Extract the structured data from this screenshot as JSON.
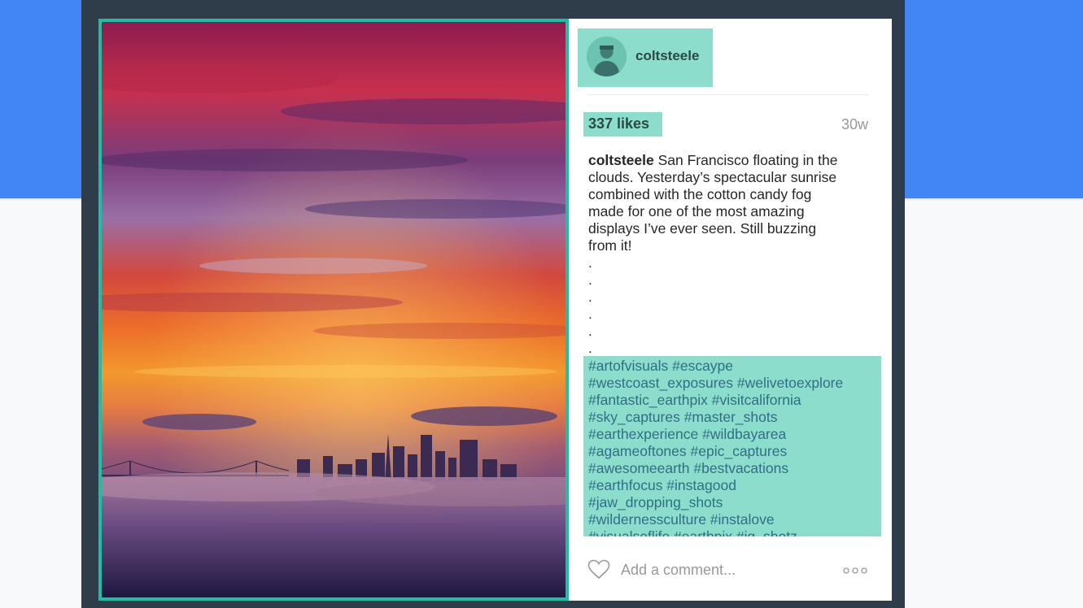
{
  "post": {
    "username": "coltsteele",
    "likes": "337 likes",
    "age": "30w",
    "caption_author": "coltsteele",
    "caption_lines": [
      "San Francisco floating in the",
      "clouds. Yesterday’s spectacular sunrise",
      "combined with the cotton candy fog",
      "made for one of the most amazing",
      "displays I’ve ever seen. Still buzzing",
      "from it!"
    ],
    "dots": [
      ".",
      ".",
      ".",
      ".",
      ".",
      "."
    ],
    "hashtag_lines": [
      "#artofvisuals #escaype",
      "#westcoast_exposures #welivetoexplore",
      "#fantastic_earthpix #visitcalifornia",
      "#sky_captures #master_shots",
      "#earthexperience #wildbayarea",
      "#agameoftones #epic_captures",
      "#awesomeearth #bestvacations",
      "#earthfocus #instagood",
      "#jaw_dropping_shots",
      "#wildernessculture #instalove",
      "#visualsoflife #earthpix #ig_shotz"
    ],
    "comment_placeholder": "Add a comment..."
  },
  "icons": {
    "like": "heart-icon",
    "more": "more-options-icon",
    "avatar": "avatar"
  },
  "colors": {
    "highlight": "#8dddcc",
    "photo_border": "#1ebea4",
    "frame": "#2f3d4b",
    "background_band": "#4285f4",
    "hashtag_text": "#2f6f86"
  }
}
